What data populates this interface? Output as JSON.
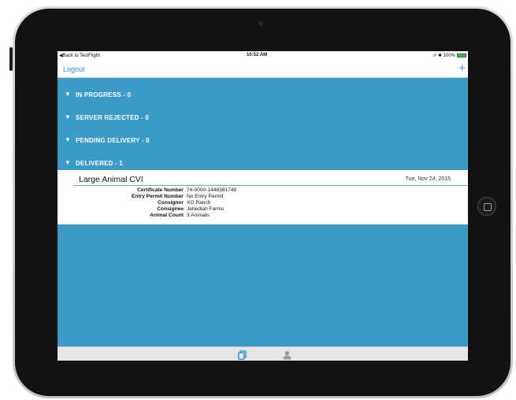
{
  "status_bar": {
    "back_text": "◀Back to TestFlight",
    "time": "10:52 AM",
    "right_text": "⇗ ✱ 100%"
  },
  "nav": {
    "logout_label": "Logout",
    "add_label": "+"
  },
  "sections": [
    {
      "label": "IN PROGRESS - 0"
    },
    {
      "label": "SERVER REJECTED - 0"
    },
    {
      "label": "PENDING DELIVERY - 0"
    },
    {
      "label": "DELIVERED - 1"
    }
  ],
  "record": {
    "title": "Large Animal CVI",
    "date": "Tue, Nov 24, 2015",
    "details": [
      {
        "label": "Certificate Number",
        "value": "74-0000-1448381748"
      },
      {
        "label": "Entry Permit Number",
        "value": "No Entry Permit"
      },
      {
        "label": "Consignor",
        "value": "XO Ranch"
      },
      {
        "label": "Consignee",
        "value": "Jebediah Farms"
      },
      {
        "label": "Animal Count",
        "value": "3 Animals"
      }
    ]
  },
  "tabs": [
    {
      "icon": "documents-icon",
      "active": true
    },
    {
      "icon": "person-icon",
      "active": false
    }
  ],
  "colors": {
    "accent": "#2f8fd3",
    "section_bg": "#3c9bc6",
    "battery": "#33c14a"
  }
}
